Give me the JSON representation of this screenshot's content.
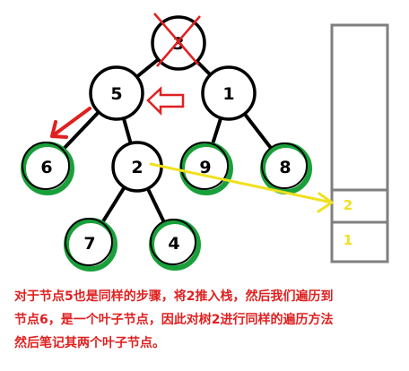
{
  "tree": {
    "nodes": [
      {
        "id": "3",
        "label": "3",
        "ring": "black",
        "crossed": true
      },
      {
        "id": "5",
        "label": "5",
        "ring": "black",
        "crossed": false
      },
      {
        "id": "1",
        "label": "1",
        "ring": "black",
        "crossed": false
      },
      {
        "id": "6",
        "label": "6",
        "ring": "green",
        "crossed": false
      },
      {
        "id": "2",
        "label": "2",
        "ring": "black",
        "crossed": false
      },
      {
        "id": "9",
        "label": "9",
        "ring": "green",
        "crossed": false
      },
      {
        "id": "8",
        "label": "8",
        "ring": "green",
        "crossed": false
      },
      {
        "id": "7",
        "label": "7",
        "ring": "green",
        "crossed": false
      },
      {
        "id": "4",
        "label": "4",
        "ring": "green",
        "crossed": false
      }
    ],
    "edges": [
      [
        "3",
        "5"
      ],
      [
        "3",
        "1"
      ],
      [
        "5",
        "6"
      ],
      [
        "5",
        "2"
      ],
      [
        "1",
        "9"
      ],
      [
        "1",
        "8"
      ],
      [
        "2",
        "7"
      ],
      [
        "2",
        "4"
      ]
    ]
  },
  "stack": {
    "slots": [
      "",
      "2",
      "1"
    ]
  },
  "colors": {
    "cross": "#e02020",
    "pointer_arrow": "#e02020",
    "down_arrow": "#e02020",
    "push_arrow": "#f0e020",
    "leaf_ring": "#1aa03a",
    "stack_border": "#7f7f7f",
    "stack_text": "#f0e020",
    "caption": "#e02020"
  },
  "caption": {
    "text": "对于节点5也是同样的步骤，将2推入栈，然后我们遍历到\n节点6，是一个叶子节点，因此对树2进行同样的遍历方法\n然后笔记其两个叶子节点。"
  }
}
